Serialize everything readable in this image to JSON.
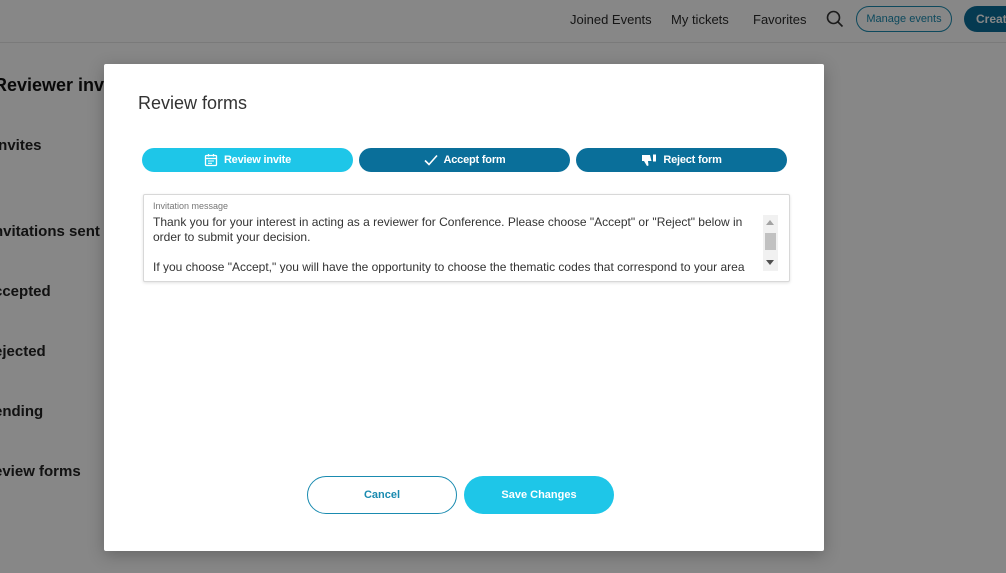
{
  "header": {
    "joined_events": "Joined Events",
    "my_tickets": "My tickets",
    "favorites": "Favorites",
    "search_icon": "search-icon",
    "manage_events": "Manage events",
    "create": "Create"
  },
  "sidebar": {
    "title": "Reviewer invite",
    "items": [
      {
        "label": "invites"
      },
      {
        "label": "nvitations sent"
      },
      {
        "label": "ccepted"
      },
      {
        "label": "ejected"
      },
      {
        "label": "ending"
      },
      {
        "label": "eview forms"
      }
    ]
  },
  "modal": {
    "title": "Review forms",
    "steps": [
      {
        "label": "Review invite",
        "icon": "calendar-icon",
        "color": "#1ec6e8"
      },
      {
        "label": "Accept form",
        "icon": "check-icon",
        "color": "#0a6f9a"
      },
      {
        "label": "Reject form",
        "icon": "thumbs-down-icon",
        "color": "#0a6f9a"
      }
    ],
    "message": {
      "label": "Invitation message",
      "text": "Thank you for your interest in acting as a reviewer for Conference. Please choose \"Accept\" or \"Reject\" below in order to submit your decision.\n\nIf you choose \"Accept,\" you will have the opportunity to choose the thematic codes that correspond to your area of"
    },
    "cancel_label": "Cancel",
    "save_label": "Save Changes"
  },
  "colors": {
    "accent": "#1ec6e8",
    "primary": "#0a6f9a",
    "outline": "#1a8bb0"
  }
}
